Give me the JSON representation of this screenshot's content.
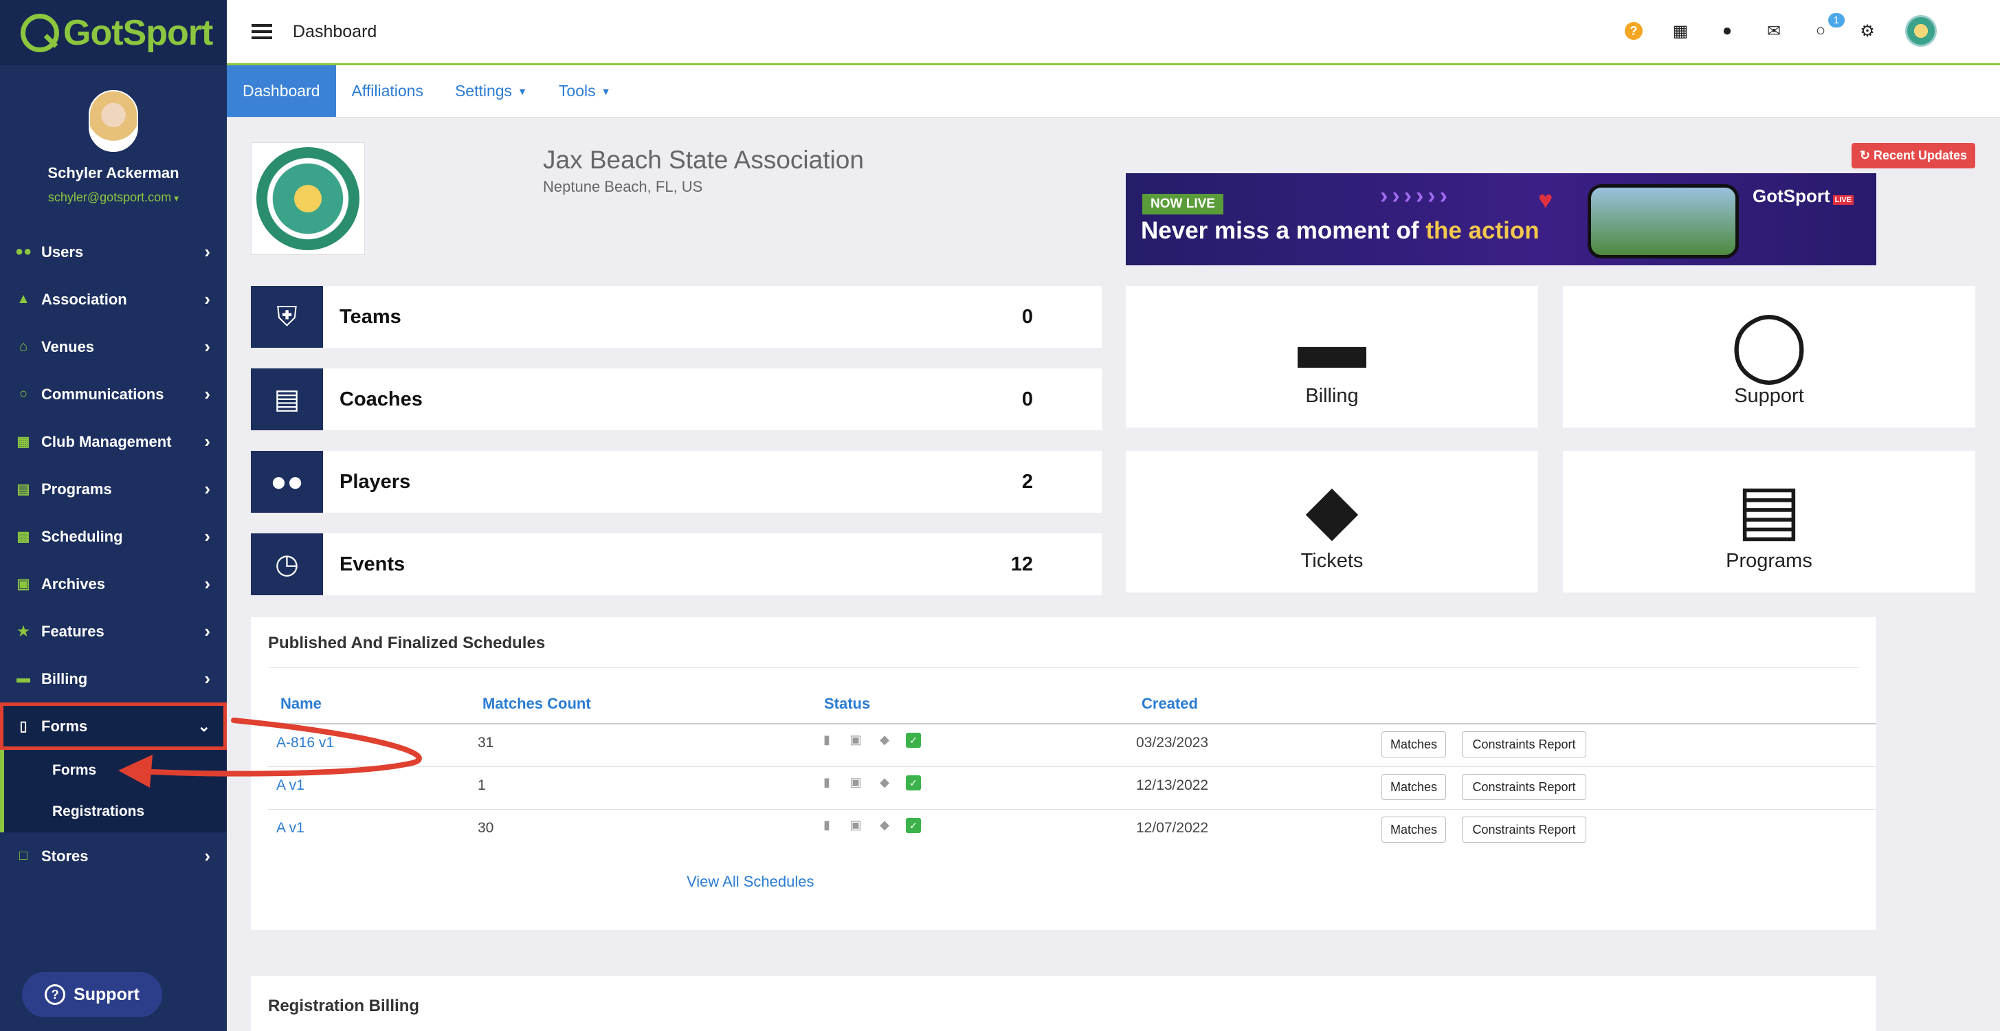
{
  "brand": {
    "logo_text": "GotSport"
  },
  "profile": {
    "name": "Schyler Ackerman",
    "email": "schyler@gotsport.com"
  },
  "sidebar": {
    "items": [
      {
        "label": "Users",
        "icon": "users-icon"
      },
      {
        "label": "Association",
        "icon": "sitemap-icon"
      },
      {
        "label": "Venues",
        "icon": "home-icon"
      },
      {
        "label": "Communications",
        "icon": "comments-icon"
      },
      {
        "label": "Club Management",
        "icon": "list-icon"
      },
      {
        "label": "Programs",
        "icon": "file-icon"
      },
      {
        "label": "Scheduling",
        "icon": "calendar-icon"
      },
      {
        "label": "Archives",
        "icon": "archive-icon"
      },
      {
        "label": "Features",
        "icon": "star-icon"
      },
      {
        "label": "Billing",
        "icon": "credit-card-icon"
      },
      {
        "label": "Forms",
        "icon": "file-outline-icon",
        "expanded": true
      },
      {
        "label": "Stores",
        "icon": "store-icon"
      }
    ],
    "forms_sub": [
      {
        "label": "Forms"
      },
      {
        "label": "Registrations"
      }
    ],
    "support_label": "Support"
  },
  "topbar": {
    "title": "Dashboard",
    "messages_badge": "1"
  },
  "tabs": [
    {
      "label": "Dashboard",
      "active": true
    },
    {
      "label": "Affiliations"
    },
    {
      "label": "Settings",
      "dropdown": true
    },
    {
      "label": "Tools",
      "dropdown": true
    }
  ],
  "org": {
    "name": "Jax Beach State Association",
    "location": "Neptune Beach, FL, US"
  },
  "recent_updates_label": "Recent Updates",
  "banner": {
    "badge": "NOW LIVE",
    "headline_prefix": "Never miss a moment of ",
    "headline_accent": "the action",
    "brand": "GotSport",
    "brand_tag": "LIVE"
  },
  "stats": [
    {
      "label": "Teams",
      "value": "0",
      "icon": "shield-icon"
    },
    {
      "label": "Coaches",
      "value": "0",
      "icon": "book-icon"
    },
    {
      "label": "Players",
      "value": "2",
      "icon": "group-icon"
    },
    {
      "label": "Events",
      "value": "12",
      "icon": "clock-icon"
    }
  ],
  "tiles": [
    {
      "label": "Billing",
      "icon": "credit-card-icon"
    },
    {
      "label": "Support",
      "icon": "chat-bubbles-icon"
    },
    {
      "label": "Tickets",
      "icon": "ticket-icon"
    },
    {
      "label": "Programs",
      "icon": "document-icon"
    }
  ],
  "schedules": {
    "title": "Published And Finalized Schedules",
    "columns": [
      "Name",
      "Matches Count",
      "Status",
      "Created"
    ],
    "rows": [
      {
        "name": "A-816 v1",
        "count": "31",
        "created": "03/23/2023"
      },
      {
        "name": "A v1",
        "count": "1",
        "created": "12/13/2022"
      },
      {
        "name": "A v1",
        "count": "30",
        "created": "12/07/2022"
      }
    ],
    "matches_btn": "Matches",
    "constraints_btn": "Constraints Report",
    "view_all": "View All Schedules"
  },
  "registration_billing": {
    "title": "Registration Billing"
  },
  "colors": {
    "sidebar": "#1c2f5e",
    "accent_green": "#8cc63f",
    "link_blue": "#2b7cd3",
    "annotation_red": "#e04030"
  }
}
